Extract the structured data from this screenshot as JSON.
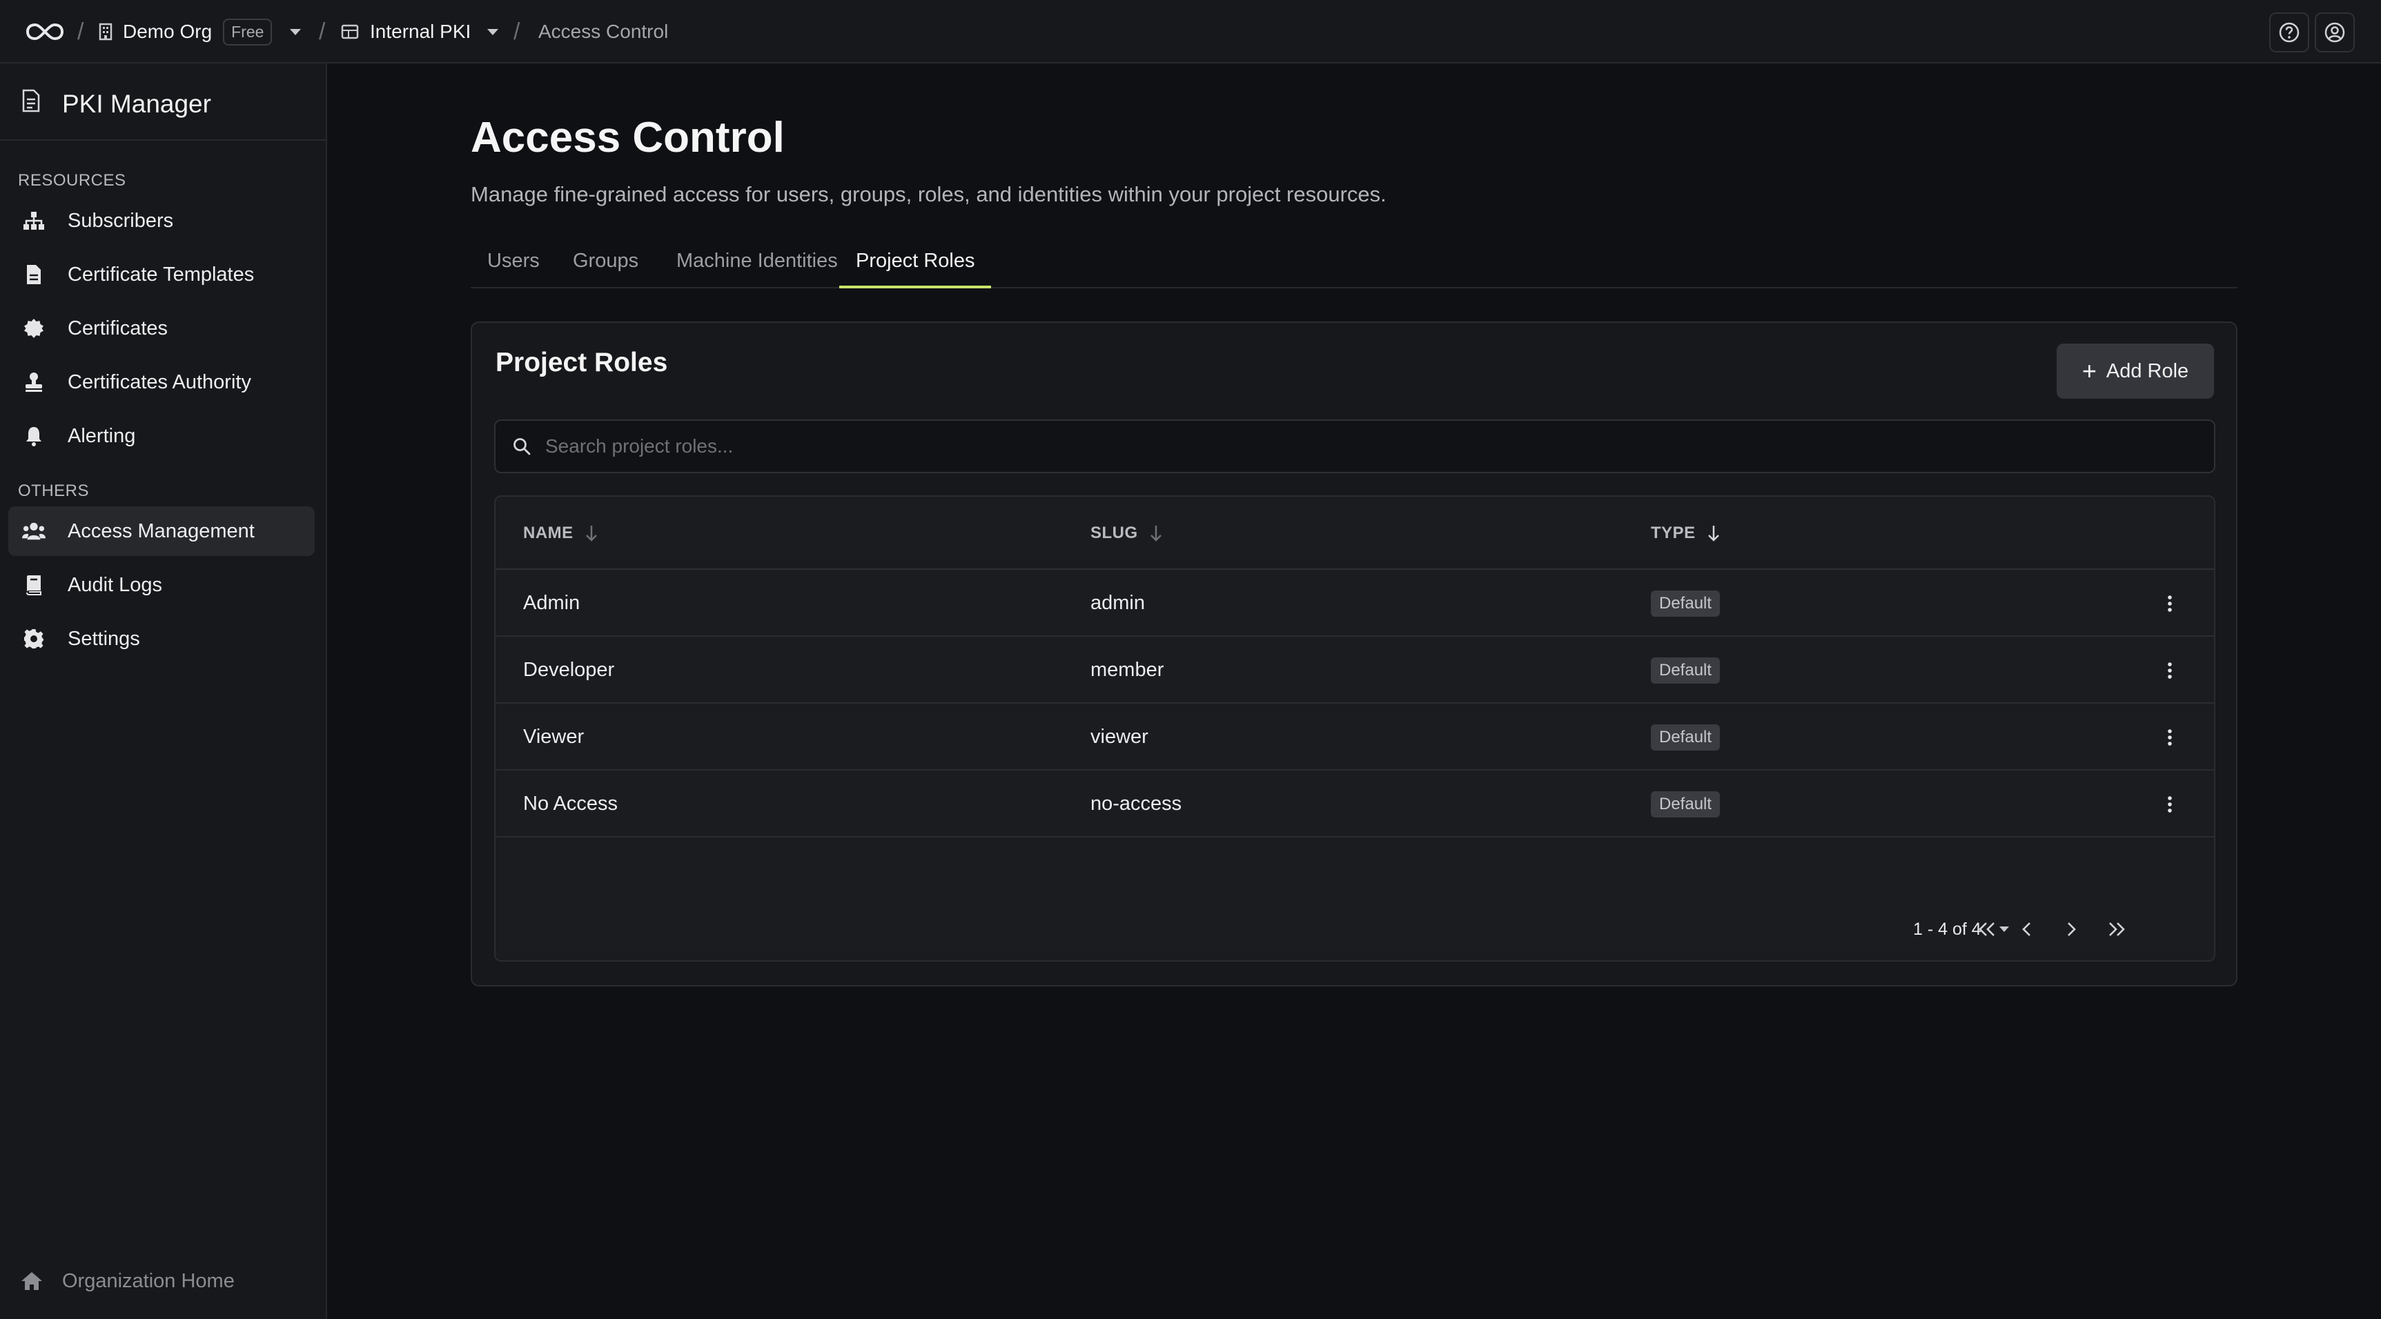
{
  "topbar": {
    "org_name": "Demo Org",
    "plan_badge": "Free",
    "project_name": "Internal PKI",
    "current_page": "Access Control",
    "separator": "/"
  },
  "sidebar": {
    "app_title": "PKI Manager",
    "sections": [
      {
        "label": "RESOURCES",
        "items": [
          {
            "label": "Subscribers",
            "icon": "sitemap-icon"
          },
          {
            "label": "Certificate Templates",
            "icon": "file-icon"
          },
          {
            "label": "Certificates",
            "icon": "certificate-badge-icon"
          },
          {
            "label": "Certificates Authority",
            "icon": "stamp-icon"
          },
          {
            "label": "Alerting",
            "icon": "bell-icon"
          }
        ]
      },
      {
        "label": "OTHERS",
        "items": [
          {
            "label": "Access Management",
            "icon": "users-icon",
            "active": true
          },
          {
            "label": "Audit Logs",
            "icon": "book-icon"
          },
          {
            "label": "Settings",
            "icon": "gear-icon"
          }
        ]
      }
    ],
    "footer": "Organization Home"
  },
  "page": {
    "title": "Access Control",
    "subtitle": "Manage fine-grained access for users, groups, roles, and identities within your project resources.",
    "tabs": [
      {
        "label": "Users"
      },
      {
        "label": "Groups"
      },
      {
        "label": "Machine Identities"
      },
      {
        "label": "Project Roles",
        "active": true
      }
    ]
  },
  "roles_card": {
    "title": "Project Roles",
    "add_button": "Add Role",
    "search_placeholder": "Search project roles...",
    "columns": [
      "NAME",
      "SLUG",
      "TYPE"
    ],
    "rows": [
      {
        "name": "Admin",
        "slug": "admin",
        "type": "Default"
      },
      {
        "name": "Developer",
        "slug": "member",
        "type": "Default"
      },
      {
        "name": "Viewer",
        "slug": "viewer",
        "type": "Default"
      },
      {
        "name": "No Access",
        "slug": "no-access",
        "type": "Default"
      }
    ],
    "pagination": {
      "range": "1 - 4 of 4"
    }
  },
  "colors": {
    "accent_underline": "#c8e26a",
    "background": "#0f1013",
    "surface": "#17181b"
  }
}
